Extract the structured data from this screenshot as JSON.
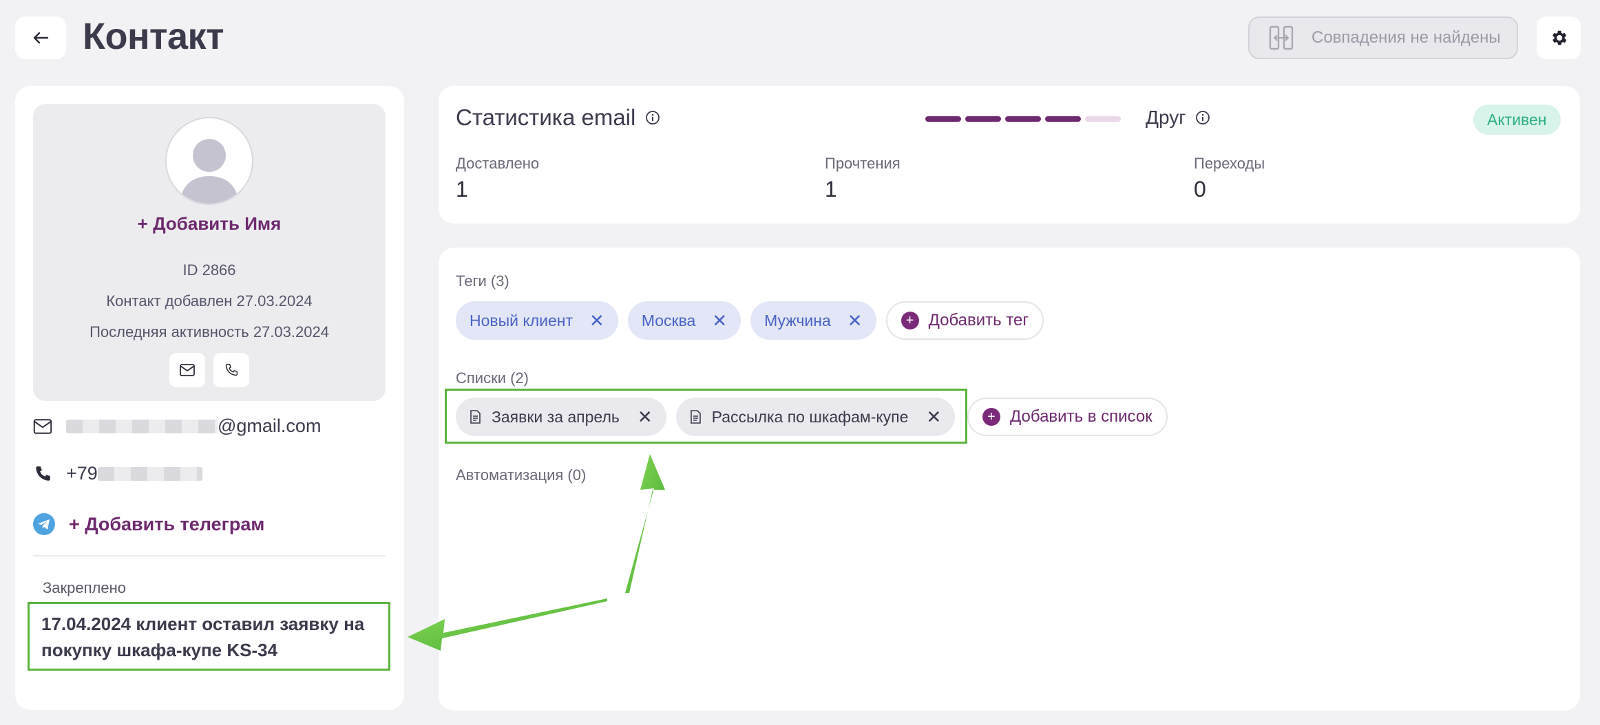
{
  "header": {
    "back_icon": "arrow-left-icon",
    "title": "Контакт",
    "duplicates_label": "Совпадения не найдены",
    "duplicates_icon": "merge-icon",
    "settings_icon": "gear-icon"
  },
  "profile": {
    "add_name": "+ Добавить Имя",
    "id": "ID 2866",
    "added": "Контакт добавлен 27.03.2024",
    "last_activity": "Последняя активность 27.03.2024",
    "email_suffix": "@gmail.com",
    "phone_prefix": "+79",
    "add_telegram": "+ Добавить телеграм",
    "pinned_label": "Закреплено",
    "pinned_text": "17.04.2024 клиент оставил заявку на покупку шкафа-купе KS-34"
  },
  "stats": {
    "title": "Статистика email",
    "relation": "Друг",
    "rating_filled": 4,
    "rating_total": 5,
    "status": "Активен",
    "items": [
      {
        "label": "Доставлено",
        "value": "1"
      },
      {
        "label": "Прочтения",
        "value": "1"
      },
      {
        "label": "Переходы",
        "value": "0"
      }
    ]
  },
  "tags": {
    "label": "Теги (3)",
    "items": [
      "Новый клиент",
      "Москва",
      "Мужчина"
    ],
    "add_label": "Добавить тег"
  },
  "lists": {
    "label": "Списки (2)",
    "items": [
      "Заявки за апрель",
      "Рассылка по шкафам-купе"
    ],
    "add_label": "Добавить в список"
  },
  "automation": {
    "label": "Автоматизация (0)"
  },
  "colors": {
    "accent": "#6e2a6e",
    "highlight": "#5bb33d",
    "tag_bg": "#e2e6f7",
    "tag_text": "#4b63c6",
    "status_bg": "#d8f3ea",
    "status_text": "#2fae86"
  }
}
